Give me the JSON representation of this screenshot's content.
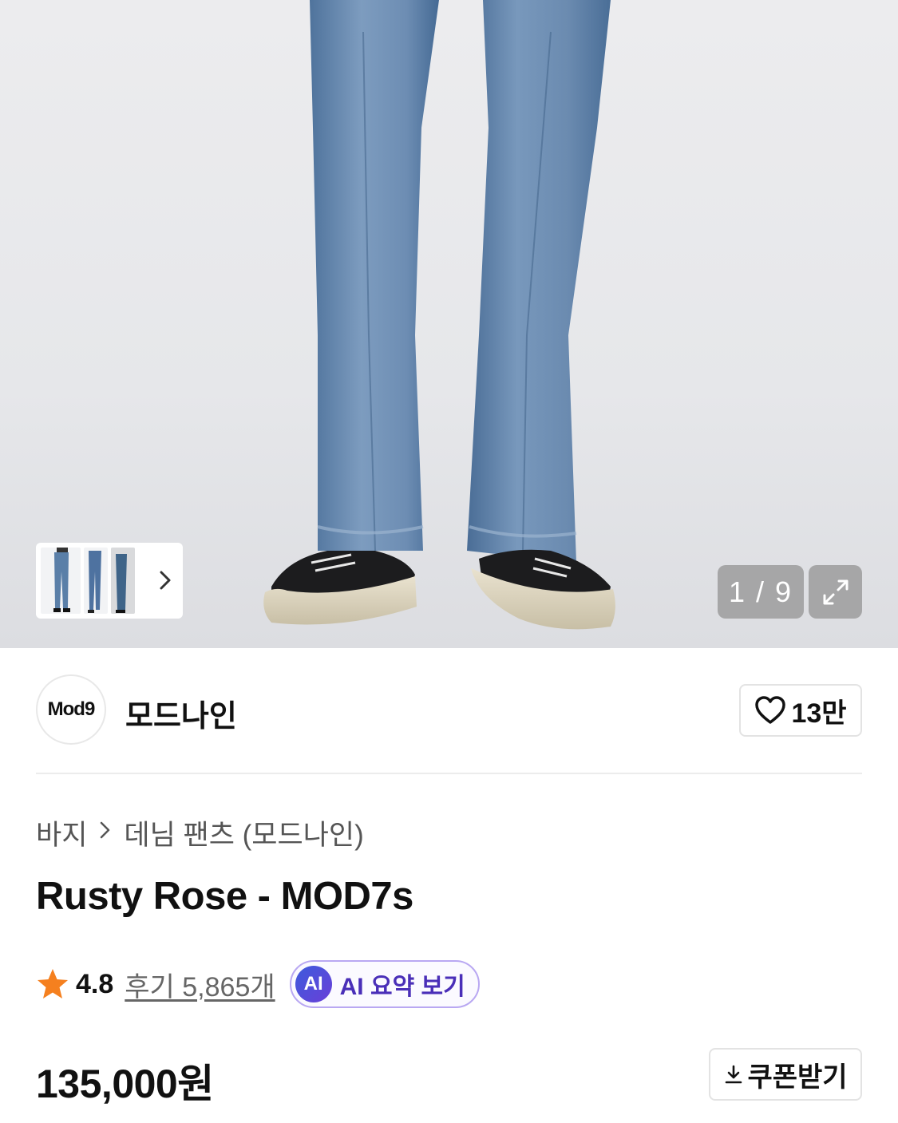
{
  "gallery": {
    "counter": "1 / 9",
    "thumbnail_count_visible": 3
  },
  "brand": {
    "logo_text": "Mod9",
    "name": "모드나인",
    "likes": "13만"
  },
  "breadcrumb": {
    "items": [
      "바지",
      "데님 팬츠 (모드나인)"
    ]
  },
  "product": {
    "title": "Rusty Rose - MOD7s",
    "rating": "4.8",
    "reviews": "후기 5,865개",
    "ai_badge": "AI",
    "ai_summary_label": "AI 요약 보기",
    "price": "135,000원",
    "coupon_label": "쿠폰받기"
  },
  "colors": {
    "accent_purple": "#4a2fb8",
    "star": "#f5801f",
    "hero_bg": "#e6e7ea"
  }
}
